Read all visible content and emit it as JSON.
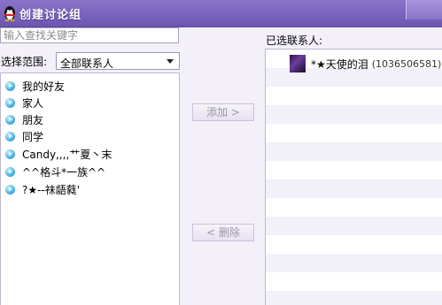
{
  "window": {
    "title": "创建讨论组"
  },
  "search": {
    "placeholder": "输入查找关键字"
  },
  "range": {
    "label": "选择范围:",
    "selected": "全部联系人"
  },
  "groups": [
    {
      "label": "我的好友"
    },
    {
      "label": "家人"
    },
    {
      "label": "朋友"
    },
    {
      "label": "同学"
    },
    {
      "label": "Candy,,,,艹夏丶末"
    },
    {
      "label": "^^格斗*一族^^"
    },
    {
      "label": "?★--祙龉蕤'"
    }
  ],
  "buttons": {
    "add": "添加 >",
    "remove": "< 删除"
  },
  "selected": {
    "label": "已选联系人:",
    "contacts": [
      {
        "name": "*★天使的泪",
        "id": "(1036506581)"
      }
    ]
  },
  "colors": {
    "titlebar": "#7a63bd",
    "window_bg": "#f4f0fa",
    "list_stripe": "#f2f0f8"
  }
}
